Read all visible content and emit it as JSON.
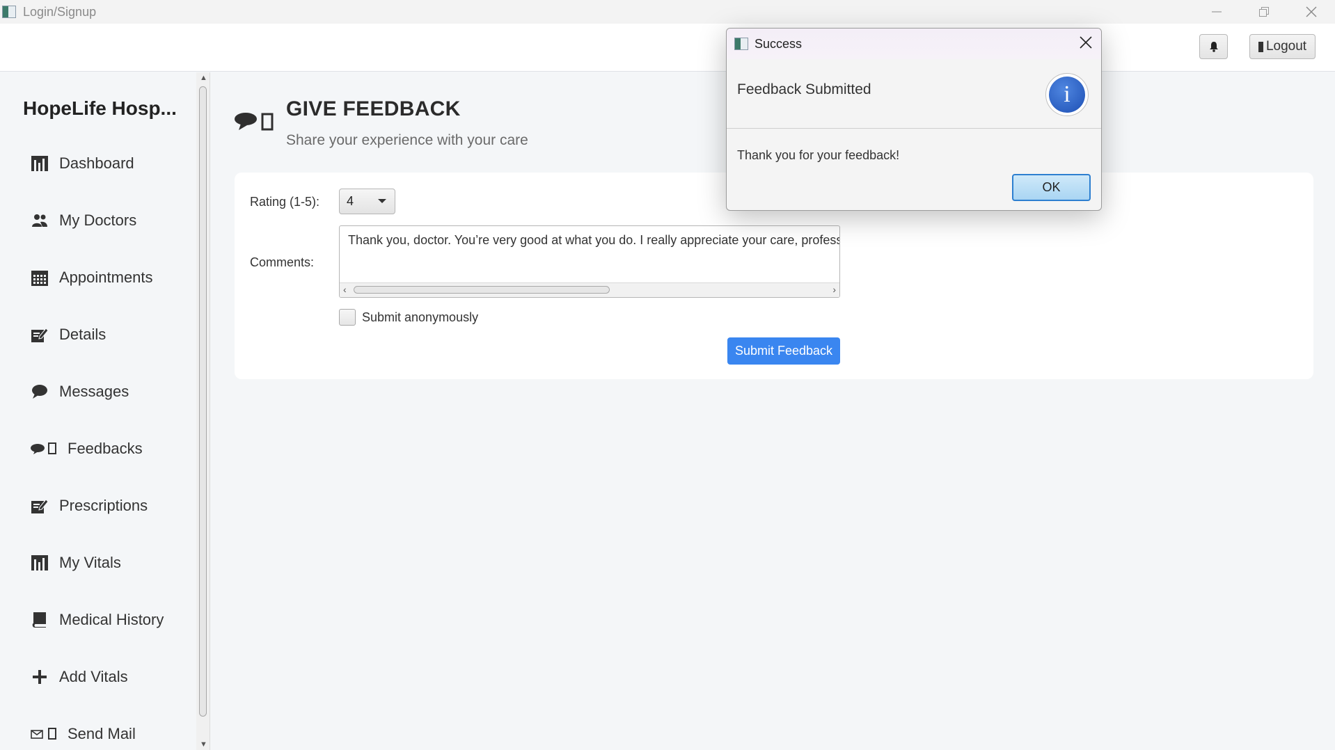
{
  "window": {
    "title": "Login/Signup"
  },
  "topbar": {
    "logout_label": "Logout"
  },
  "sidebar": {
    "brand": "HopeLife Hosp...",
    "items": [
      {
        "label": "Dashboard",
        "icon": "bar-chart-icon"
      },
      {
        "label": "My Doctors",
        "icon": "users-icon"
      },
      {
        "label": "Appointments",
        "icon": "calendar-icon"
      },
      {
        "label": "Details",
        "icon": "edit-icon"
      },
      {
        "label": "Messages",
        "icon": "chat-bubble-icon"
      },
      {
        "label": "Feedbacks",
        "icon": "feedback-icon"
      },
      {
        "label": "Prescriptions",
        "icon": "edit-icon"
      },
      {
        "label": "My Vitals",
        "icon": "bar-chart-icon"
      },
      {
        "label": "Medical History",
        "icon": "book-icon"
      },
      {
        "label": "Add Vitals",
        "icon": "plus-icon"
      },
      {
        "label": "Send Mail",
        "icon": "mail-icon"
      }
    ]
  },
  "page": {
    "title": "GIVE FEEDBACK",
    "subtitle": "Share your experience with your care"
  },
  "form": {
    "rating_label": "Rating (1-5):",
    "rating_value": "4",
    "comments_label": "Comments:",
    "comments_value": "Thank you, doctor. You’re very good at what you do. I really appreciate your care, profess",
    "anonymous_label": "Submit anonymously",
    "anonymous_checked": false,
    "submit_label": "Submit Feedback"
  },
  "dialog": {
    "title": "Success",
    "header": "Feedback Submitted",
    "content": "Thank you for your feedback!",
    "ok_label": "OK",
    "icon_letter": "i"
  },
  "colors": {
    "accent": "#3a86f0",
    "info_icon": "#1d4fb4"
  }
}
